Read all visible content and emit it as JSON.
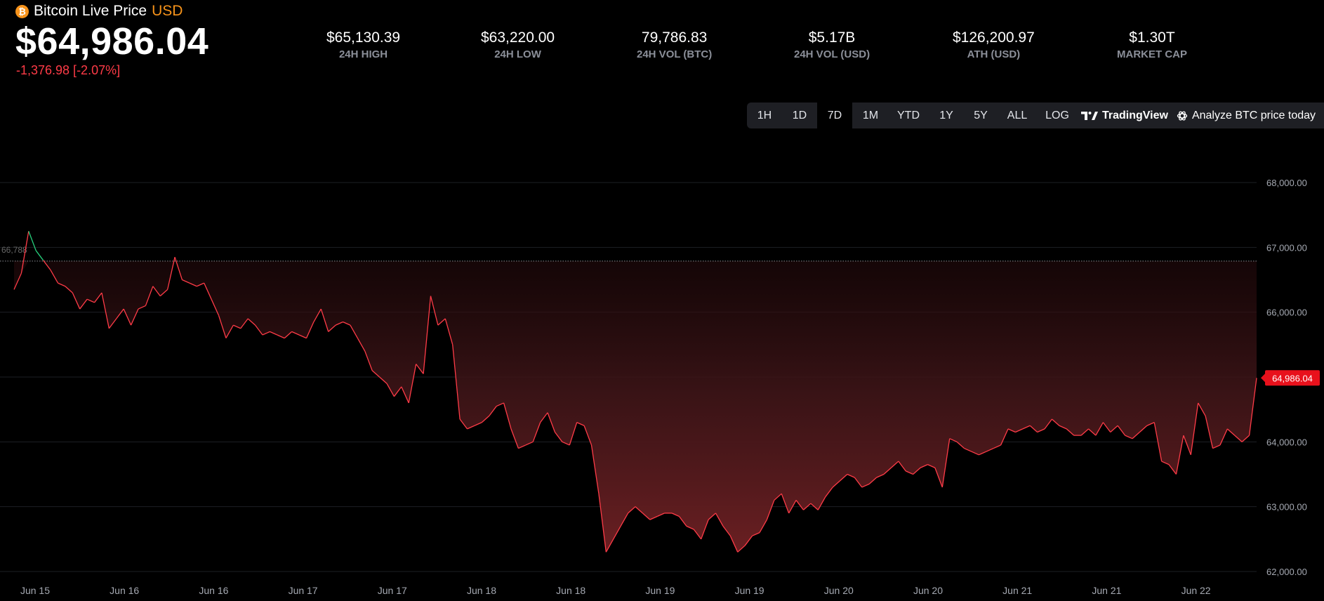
{
  "header": {
    "title": "Bitcoin Live Price",
    "currency": "USD",
    "btc_icon_glyph": "₿",
    "price": "$64,986.04",
    "change": "-1,376.98 [-2.07%]"
  },
  "stats": [
    {
      "value": "$65,130.39",
      "label": "24H HIGH"
    },
    {
      "value": "$63,220.00",
      "label": "24H LOW"
    },
    {
      "value": "79,786.83",
      "label": "24H VOL (BTC)"
    },
    {
      "value": "$5.17B",
      "label": "24H VOL (USD)"
    },
    {
      "value": "$126,200.97",
      "label": "ATH (USD)"
    },
    {
      "value": "$1.30T",
      "label": "MARKET CAP"
    }
  ],
  "toolbar": {
    "ranges": [
      "1H",
      "1D",
      "7D",
      "1M",
      "YTD",
      "1Y",
      "5Y",
      "ALL",
      "LOG"
    ],
    "active_range": "7D",
    "tradingview_label": "TradingView",
    "analyze_label": "Analyze BTC price today"
  },
  "colors": {
    "up": "#26d07c",
    "down": "#ff3b47",
    "price_tag": "#e8111c",
    "grid": "#1d1f24",
    "axis_text": "#a5a9b2",
    "accent_btc": "#f7931a"
  },
  "chart_data": {
    "type": "area",
    "title": "",
    "xlabel": "",
    "ylabel": "",
    "ylim": [
      62000,
      68000
    ],
    "y_ticks": [
      "68,000.00",
      "67,000.00",
      "66,000.00",
      "65,000.00",
      "64,000.00",
      "63,000.00",
      "62,000.00"
    ],
    "y_tick_values": [
      68000,
      67000,
      66000,
      65000,
      64000,
      63000,
      62000
    ],
    "x_tick_labels": [
      "Jun 15",
      "Jun 16",
      "Jun 16",
      "Jun 17",
      "Jun 17",
      "Jun 18",
      "Jun 18",
      "Jun 19",
      "Jun 19",
      "Jun 20",
      "Jun 20",
      "Jun 21",
      "Jun 21",
      "Jun 22"
    ],
    "baseline_value": 66788,
    "baseline_label": "66,788",
    "last_price": 64986.04,
    "last_price_label": "64,986.04",
    "grid": true,
    "x": [
      "Jun 15",
      "Jun 15",
      "Jun 15",
      "Jun 15",
      "Jun 15",
      "Jun 15",
      "Jun 15",
      "Jun 15",
      "Jun 15",
      "Jun 15",
      "Jun 15",
      "Jun 15",
      "Jun 15",
      "Jun 15",
      "Jun 15",
      "Jun 15",
      "Jun 15",
      "Jun 16",
      "Jun 16",
      "Jun 16",
      "Jun 16",
      "Jun 16",
      "Jun 16",
      "Jun 16",
      "Jun 16",
      "Jun 16",
      "Jun 16",
      "Jun 16",
      "Jun 16",
      "Jun 16",
      "Jun 16",
      "Jun 16",
      "Jun 16",
      "Jun 16",
      "Jun 16",
      "Jun 16",
      "Jun 16",
      "Jun 16",
      "Jun 16",
      "Jun 16",
      "Jun 16",
      "Jun 16",
      "Jun 17",
      "Jun 17",
      "Jun 17",
      "Jun 17",
      "Jun 17",
      "Jun 17",
      "Jun 17",
      "Jun 17",
      "Jun 17",
      "Jun 17",
      "Jun 17",
      "Jun 17",
      "Jun 17",
      "Jun 17",
      "Jun 17",
      "Jun 17",
      "Jun 17",
      "Jun 17",
      "Jun 17",
      "Jun 17",
      "Jun 17",
      "Jun 17",
      "Jun 17",
      "Jun 17",
      "Jun 17",
      "Jun 17",
      "Jun 17",
      "Jun 18",
      "Jun 18",
      "Jun 18",
      "Jun 18",
      "Jun 18",
      "Jun 18",
      "Jun 18",
      "Jun 18",
      "Jun 18",
      "Jun 18",
      "Jun 18",
      "Jun 18",
      "Jun 18",
      "Jun 18",
      "Jun 18",
      "Jun 18",
      "Jun 18",
      "Jun 18",
      "Jun 18",
      "Jun 18",
      "Jun 18",
      "Jun 18",
      "Jun 18",
      "Jun 18",
      "Jun 18",
      "Jun 18",
      "Jun 19",
      "Jun 19",
      "Jun 19",
      "Jun 19",
      "Jun 19",
      "Jun 19",
      "Jun 19",
      "Jun 19",
      "Jun 19",
      "Jun 19",
      "Jun 19",
      "Jun 19",
      "Jun 19",
      "Jun 19",
      "Jun 19",
      "Jun 19",
      "Jun 19",
      "Jun 19",
      "Jun 19",
      "Jun 19",
      "Jun 19",
      "Jun 19",
      "Jun 19",
      "Jun 20",
      "Jun 20",
      "Jun 20",
      "Jun 20",
      "Jun 20",
      "Jun 20",
      "Jun 20",
      "Jun 20",
      "Jun 20",
      "Jun 20",
      "Jun 20",
      "Jun 20",
      "Jun 20",
      "Jun 20",
      "Jun 20",
      "Jun 20",
      "Jun 20",
      "Jun 20",
      "Jun 20",
      "Jun 20",
      "Jun 20",
      "Jun 20",
      "Jun 20",
      "Jun 21",
      "Jun 21",
      "Jun 21",
      "Jun 21",
      "Jun 21",
      "Jun 21",
      "Jun 21",
      "Jun 21",
      "Jun 21",
      "Jun 21",
      "Jun 21",
      "Jun 21",
      "Jun 21",
      "Jun 21",
      "Jun 21",
      "Jun 21",
      "Jun 21",
      "Jun 21",
      "Jun 21",
      "Jun 21",
      "Jun 21",
      "Jun 22",
      "Jun 22",
      "Jun 22",
      "Jun 22",
      "Jun 22",
      "Jun 22",
      "Jun 22",
      "Jun 22",
      "Jun 22",
      "Jun 22",
      "Jun 22"
    ],
    "series": [
      {
        "values": [
          66350,
          66600,
          67250,
          66950,
          66800,
          66650,
          66450,
          66400,
          66300,
          66050,
          66200,
          66150,
          66300,
          65750,
          65900,
          66050,
          65800,
          66050,
          66100,
          66400,
          66250,
          66350,
          66850,
          66500,
          66450,
          66400,
          66450,
          66200,
          65950,
          65600,
          65800,
          65750,
          65900,
          65800,
          65650,
          65700,
          65650,
          65600,
          65700,
          65650,
          65600,
          65850,
          66050,
          65700,
          65800,
          65850,
          65800,
          65600,
          65400,
          65100,
          65000,
          64900,
          64700,
          64850,
          64600,
          65200,
          65050,
          66250,
          65800,
          65900,
          65500,
          64350,
          64200,
          64250,
          64300,
          64400,
          64550,
          64600,
          64200,
          63900,
          63950,
          64000,
          64300,
          64450,
          64150,
          64000,
          63950,
          64300,
          64250,
          63950,
          63200,
          62300,
          62500,
          62700,
          62900,
          63000,
          62900,
          62800,
          62850,
          62900,
          62900,
          62850,
          62700,
          62650,
          62500,
          62800,
          62900,
          62700,
          62550,
          62300,
          62400,
          62550,
          62600,
          62800,
          63100,
          63200,
          62900,
          63100,
          62950,
          63050,
          62950,
          63150,
          63300,
          63400,
          63500,
          63450,
          63300,
          63350,
          63450,
          63500,
          63600,
          63700,
          63550,
          63500,
          63600,
          63650,
          63600,
          63300,
          64050,
          64000,
          63900,
          63850,
          63800,
          63850,
          63900,
          63950,
          64200,
          64150,
          64200,
          64250,
          64150,
          64200,
          64350,
          64250,
          64200,
          64100,
          64100,
          64200,
          64100,
          64300,
          64150,
          64250,
          64100,
          64050,
          64150,
          64250,
          64300,
          63700,
          63650,
          63500,
          64100,
          63800,
          64600,
          64400,
          63900,
          63950,
          64200,
          64100,
          64000,
          64100,
          64986.04
        ]
      }
    ]
  }
}
